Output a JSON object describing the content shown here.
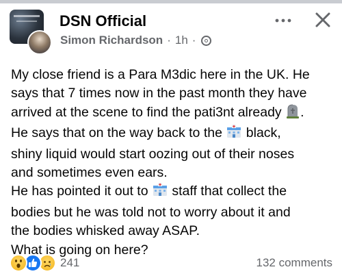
{
  "post": {
    "group_name": "DSN Official",
    "author": "Simon Richardson",
    "separator": "·",
    "time": "1h",
    "privacy_icon": "globe-icon",
    "more_icon": "more-options-icon",
    "close_icon": "close-icon",
    "lines": [
      [
        "My close friend is a Para M3dic here in the UK. He"
      ],
      [
        "says that 7 times now in the past month they have"
      ],
      [
        "arrived at the scene to find the pati3nt already ",
        "{headstone}",
        "."
      ],
      [
        "He says that on the way back to the ",
        "{hospital}",
        " black,"
      ],
      [
        "shiny liquid would start oozing out of their noses"
      ],
      [
        "and sometimes even ears."
      ],
      [
        "He has pointed it out to ",
        "{hospital}",
        " staff that collect the"
      ],
      [
        "bodies but he was told not to worry about it and"
      ],
      [
        "the bodies whisked away ASAP."
      ],
      [
        "What is going on here?"
      ]
    ],
    "inline_emoji": {
      "headstone": "headstone-emoji",
      "hospital": "hospital-emoji"
    }
  },
  "footer": {
    "reaction_icons": [
      "wow-reaction-icon",
      "like-reaction-icon",
      "sad-reaction-icon"
    ],
    "reaction_count": "241",
    "comments_label": "132 comments"
  },
  "colors": {
    "text": "#050505",
    "meta": "#65676b",
    "like_blue": "#1877f2",
    "emoji_yellow": "#f7c130"
  }
}
